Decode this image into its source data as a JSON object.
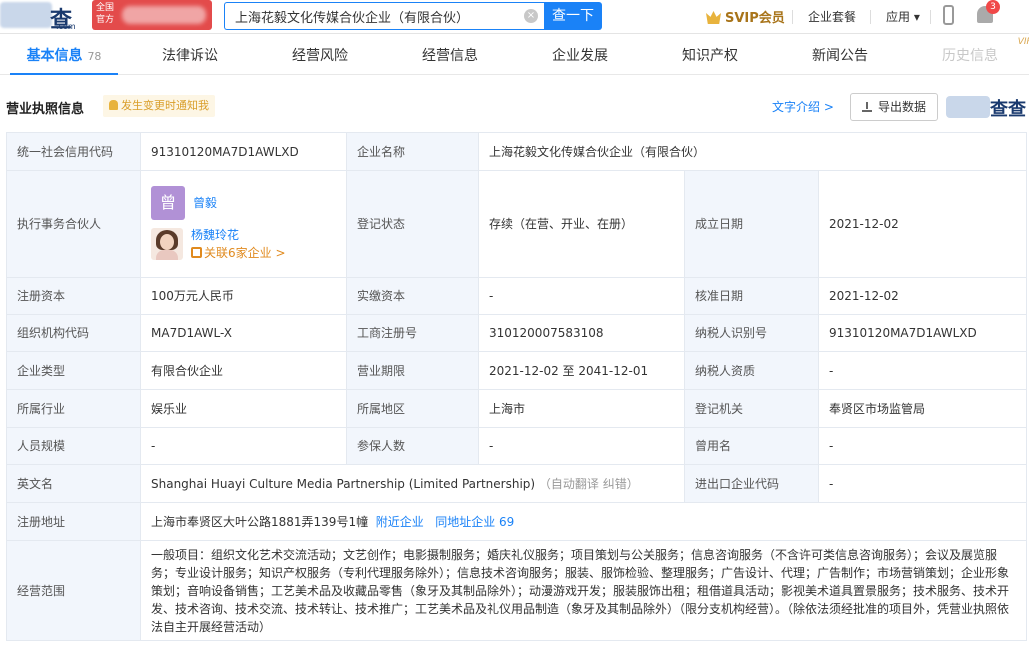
{
  "header": {
    "logo_text": "查查",
    "logo_sub": ".com",
    "badge_text": "全国\n官方",
    "search_value": "上海花毅文化传媒合伙企业（有限合伙）",
    "search_button": "查一下",
    "svip": "SVIP会员",
    "nav": [
      "企业套餐",
      "应用 ▾"
    ],
    "notification_count": "3"
  },
  "tabs": [
    {
      "label": "基本信息",
      "count": "78"
    },
    {
      "label": "法律诉讼"
    },
    {
      "label": "经营风险"
    },
    {
      "label": "经营信息"
    },
    {
      "label": "企业发展"
    },
    {
      "label": "知识产权"
    },
    {
      "label": "新闻公告"
    },
    {
      "label": "历史信息",
      "tag": "VIP"
    }
  ],
  "section": {
    "title": "营业执照信息",
    "notice": "发生变更时通知我",
    "text_intro": "文字介绍 >",
    "export": "导出数据",
    "watermark": "查查"
  },
  "info": {
    "credit_code_label": "统一社会信用代码",
    "credit_code": "91310120MA7D1AWLXD",
    "company_name_label": "企业名称",
    "company_name": "上海花毅文化传媒合伙企业（有限合伙）",
    "partner_label": "执行事务合伙人",
    "partner1_avatar": "曾",
    "partner1_name": "曾毅",
    "partner2_name": "杨魏玲花",
    "partner2_related": "关联6家企业 >",
    "status_label": "登记状态",
    "status": "存续（在营、开业、在册）",
    "found_label": "成立日期",
    "found_date": "2021-12-02",
    "capital_label": "注册资本",
    "capital": "100万元人民币",
    "paid_label": "实缴资本",
    "paid": "-",
    "approve_label": "核准日期",
    "approve_date": "2021-12-02",
    "org_code_label": "组织机构代码",
    "org_code": "MA7D1AWL-X",
    "reg_no_label": "工商注册号",
    "reg_no": "310120007583108",
    "taxpayer_label": "纳税人识别号",
    "taxpayer_no": "91310120MA7D1AWLXD",
    "type_label": "企业类型",
    "type": "有限合伙企业",
    "term_label": "营业期限",
    "term": "2021-12-02 至 2041-12-01",
    "tax_quali_label": "纳税人资质",
    "tax_quali": "-",
    "industry_label": "所属行业",
    "industry": "娱乐业",
    "region_label": "所属地区",
    "region": "上海市",
    "authority_label": "登记机关",
    "authority": "奉贤区市场监管局",
    "staff_label": "人员规模",
    "staff": "-",
    "insured_label": "参保人数",
    "insured": "-",
    "former_label": "曾用名",
    "former": "-",
    "en_label": "英文名",
    "en_name": "Shanghai Huayi Culture Media Partnership (Limited Partnership)",
    "en_note": "（自动翻译 纠错）",
    "ie_label": "进出口企业代码",
    "ie_code": "-",
    "addr_label": "注册地址",
    "addr": "上海市奉贤区大叶公路1881弄139号1幢",
    "nearby": "附近企业",
    "same_addr": "同地址企业 69",
    "scope_label": "经营范围",
    "scope": "一般项目：组织文化艺术交流活动；文艺创作；电影摄制服务；婚庆礼仪服务；项目策划与公关服务；信息咨询服务（不含许可类信息咨询服务）；会议及展览服务；专业设计服务；知识产权服务（专利代理服务除外）；信息技术咨询服务；服装、服饰检验、整理服务；广告设计、代理；广告制作；市场营销策划；企业形象策划；音响设备销售；工艺美术品及收藏品零售（象牙及其制品除外）；动漫游戏开发；服装服饰出租；租借道具活动；影视美术道具置景服务；技术服务、技术开发、技术咨询、技术交流、技术转让、技术推广；工艺美术品及礼仪用品制造（象牙及其制品除外）（限分支机构经营）。（除依法须经批准的项目外，凭营业执照依法自主开展经营活动）"
  }
}
